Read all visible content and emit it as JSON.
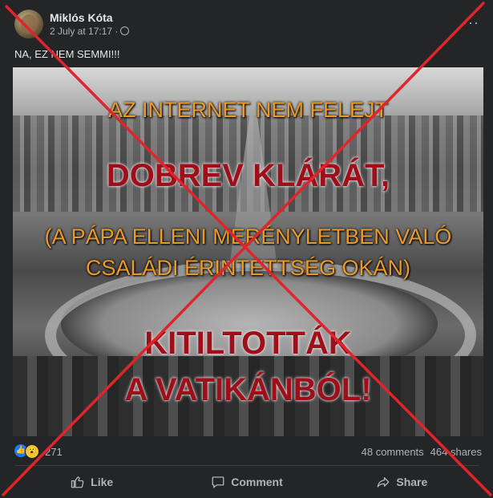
{
  "post": {
    "author": "Miklós Kóta",
    "timestamp": "2 July at 17:17 ·",
    "privacy_icon": "globe-icon",
    "more_label": "···",
    "text": "NA, EZ NEM SEMMI!!!"
  },
  "image": {
    "line1": "AZ INTERNET NEM FELEJT",
    "line2": "DOBREV KLÁRÁT,",
    "line3": "(A PÁPA ELLENI MERÉNYLETBEN VALÓ",
    "line4": "CSALÁDI ÉRINTETTSÉG OKÁN)",
    "line5": "KITILTOTTÁK",
    "line6": "A VATIKÁNBÓL!"
  },
  "reactions": {
    "icons": [
      "like-reaction-icon",
      "wow-reaction-icon"
    ],
    "count": "271",
    "comments": "48 comments",
    "shares": "464 shares"
  },
  "actions": {
    "like": "Like",
    "comment": "Comment",
    "share": "Share"
  },
  "colors": {
    "background": "#242526",
    "overlay_orange": "#e89a2a",
    "overlay_red": "#9e0f1a",
    "cross_red": "#e0242b"
  }
}
